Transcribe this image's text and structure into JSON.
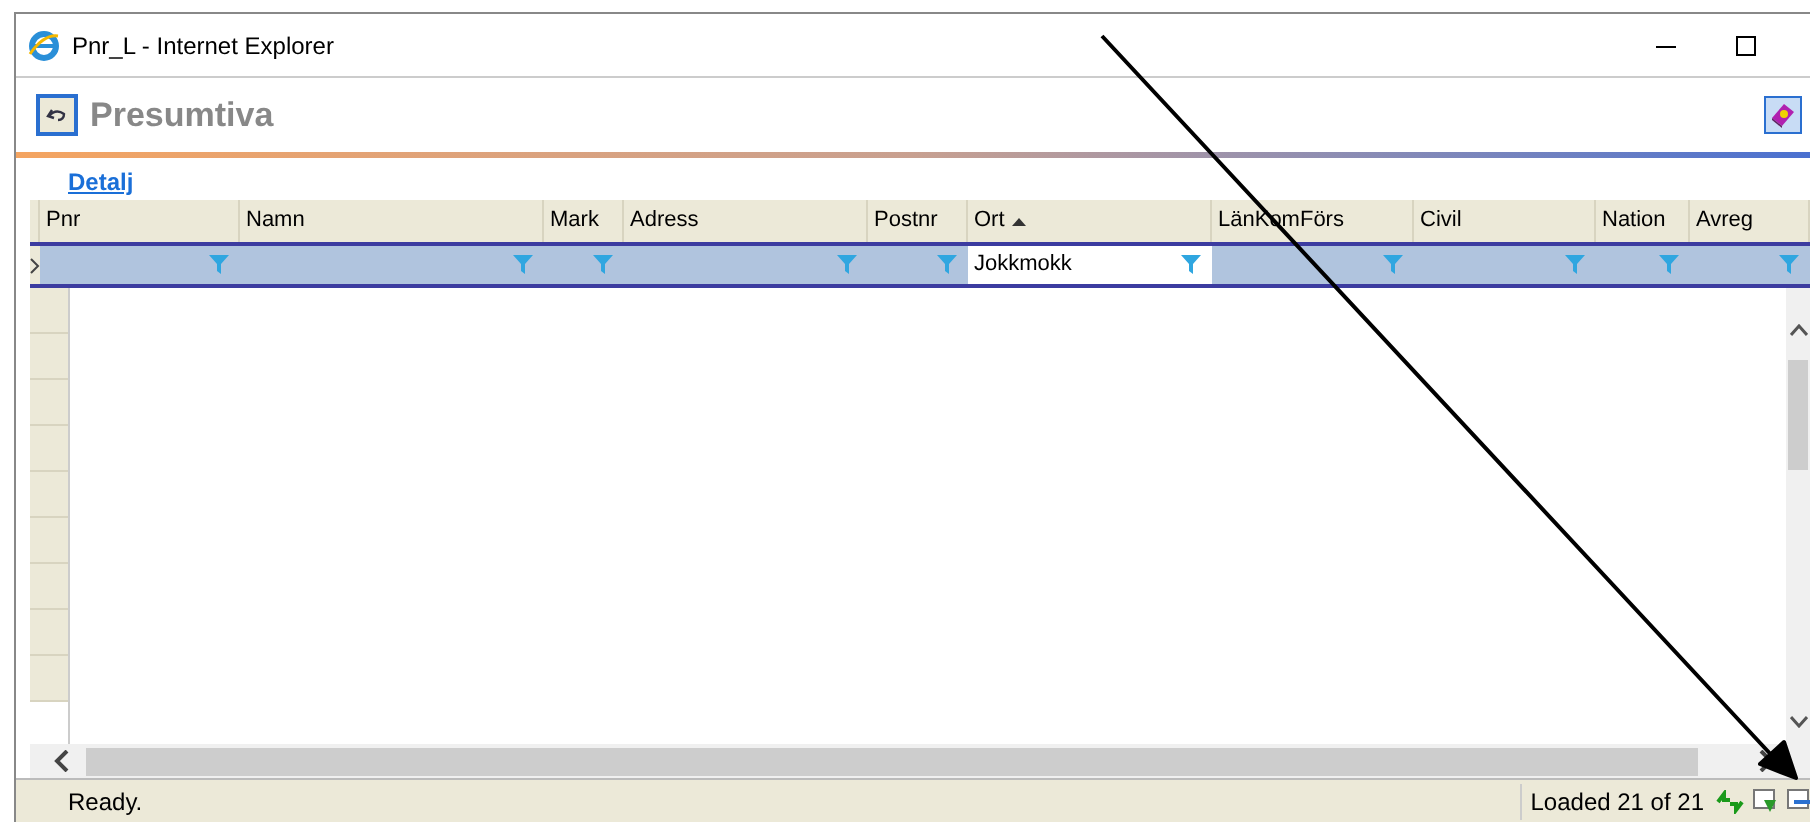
{
  "window": {
    "title": "Pnr_L - Internet Explorer"
  },
  "header": {
    "title": "Presumtiva"
  },
  "link": "Detalj",
  "columns": [
    {
      "label": "Pnr",
      "sorted": false
    },
    {
      "label": "Namn",
      "sorted": false
    },
    {
      "label": "Mark",
      "sorted": false
    },
    {
      "label": "Adress",
      "sorted": false
    },
    {
      "label": "Postnr",
      "sorted": false
    },
    {
      "label": "Ort",
      "sorted": true,
      "filter": "Jokkmokk"
    },
    {
      "label": "LänKomFörs",
      "sorted": false
    },
    {
      "label": "Civil",
      "sorted": false
    },
    {
      "label": "Nation",
      "sorted": false
    },
    {
      "label": "Avreg",
      "sorted": false
    }
  ],
  "status_bar": {
    "message": "Ready.",
    "count": "Loaded 21 of 21"
  }
}
